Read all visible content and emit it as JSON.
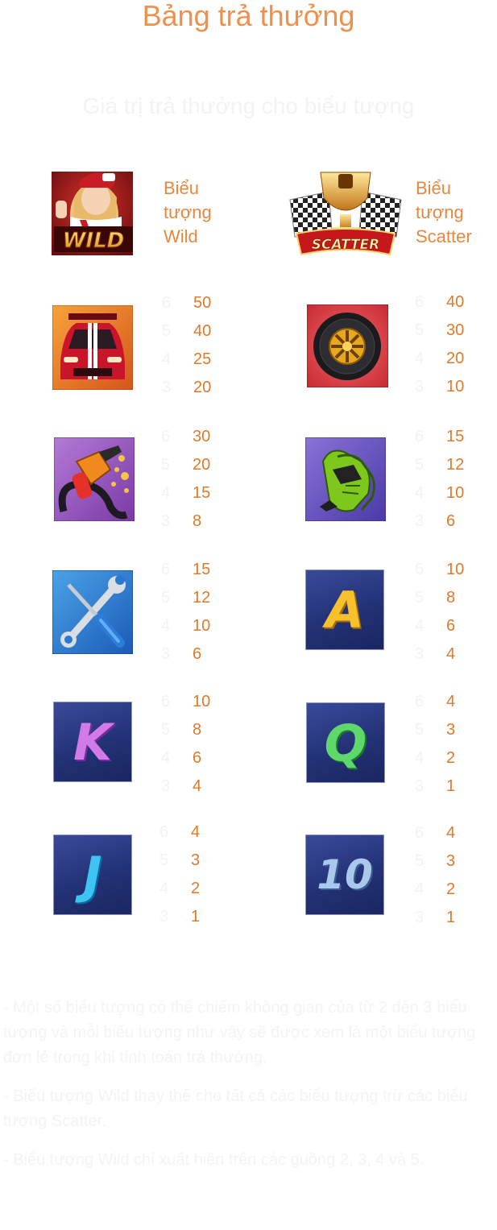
{
  "title": "Bảng trả thưởng",
  "subtitle": "Giá trị trả thưởng cho biểu tượng",
  "wild": {
    "label": [
      "Biểu",
      "tượng",
      "Wild"
    ],
    "badge": "WILD"
  },
  "scatter": {
    "label": [
      "Biểu",
      "tượng",
      "Scatter"
    ],
    "badge": "SCATTER"
  },
  "counts": [
    "6",
    "5",
    "4",
    "3"
  ],
  "symbols": [
    {
      "name": "car",
      "values": [
        "50",
        "40",
        "25",
        "20"
      ]
    },
    {
      "name": "tire",
      "values": [
        "40",
        "30",
        "20",
        "10"
      ]
    },
    {
      "name": "fuel-nozzle",
      "values": [
        "30",
        "20",
        "15",
        "8"
      ]
    },
    {
      "name": "gloves",
      "values": [
        "15",
        "12",
        "10",
        "6"
      ]
    },
    {
      "name": "tools",
      "values": [
        "15",
        "12",
        "10",
        "6"
      ]
    },
    {
      "name": "letter-a",
      "letter": "A",
      "values": [
        "10",
        "8",
        "6",
        "4"
      ]
    },
    {
      "name": "letter-k",
      "letter": "K",
      "values": [
        "10",
        "8",
        "6",
        "4"
      ]
    },
    {
      "name": "letter-q",
      "letter": "Q",
      "values": [
        "4",
        "3",
        "2",
        "1"
      ]
    },
    {
      "name": "letter-j",
      "letter": "J",
      "values": [
        "4",
        "3",
        "2",
        "1"
      ]
    },
    {
      "name": "number-10",
      "letter": "10",
      "values": [
        "4",
        "3",
        "2",
        "1"
      ]
    }
  ],
  "notes": [
    "- Một số biểu tượng có thể chiếm không gian của từ 2 đến 3 biểu tượng và mỗi biểu tượng như vậy sẽ được xem là một biểu tượng đơn lẻ trong khi tính toán trả thưởng.",
    "- Biểu tượng Wild thay thế cho tất cả các biểu tượng trừ các biểu tượng Scatter.",
    "- Biểu tượng Wild chỉ xuất hiện trên các guồng 2, 3, 4 và 5."
  ],
  "colors": {
    "accent": "#f0904a",
    "value": "#e07a2a",
    "faint": "#f3f3f3"
  }
}
